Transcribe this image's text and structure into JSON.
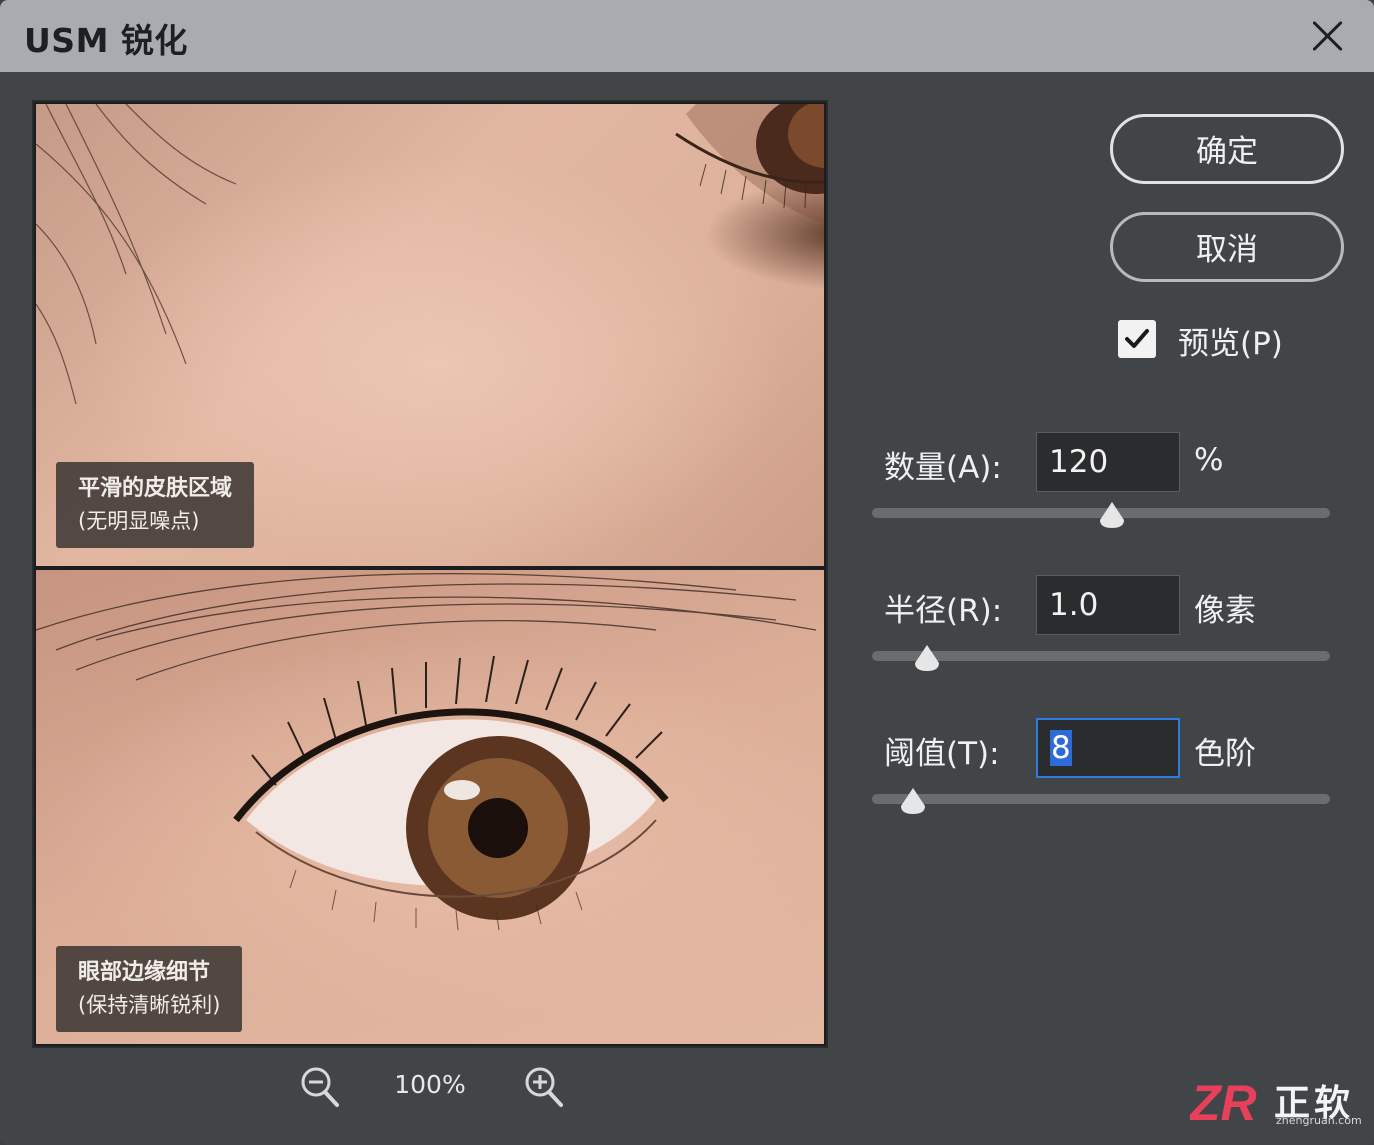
{
  "window": {
    "title": "USM 锐化"
  },
  "preview": {
    "top_caption": {
      "line1": "平滑的皮肤区域",
      "line2": "(无明显噪点)"
    },
    "bottom_caption": {
      "line1": "眼部边缘细节",
      "line2": "(保持清晰锐利)"
    },
    "zoom_level": "100%"
  },
  "buttons": {
    "ok": "确定",
    "cancel": "取消"
  },
  "preview_toggle": {
    "label": "预览(P)",
    "checked": true
  },
  "params": {
    "amount": {
      "label": "数量(A):",
      "value": "120",
      "unit": "%",
      "slider_fraction": 0.525
    },
    "radius": {
      "label": "半径(R):",
      "value": "1.0",
      "unit": "像素",
      "slider_fraction": 0.12
    },
    "threshold": {
      "label": "阈值(T):",
      "value": "8",
      "unit": "色阶",
      "slider_fraction": 0.09
    }
  },
  "watermark": {
    "mark": "ZR",
    "name": "正软",
    "site": "zhengruan.com"
  },
  "colors": {
    "titlebar": "#a8acb0",
    "panel": "#424548",
    "focus": "#2f7ce0"
  }
}
